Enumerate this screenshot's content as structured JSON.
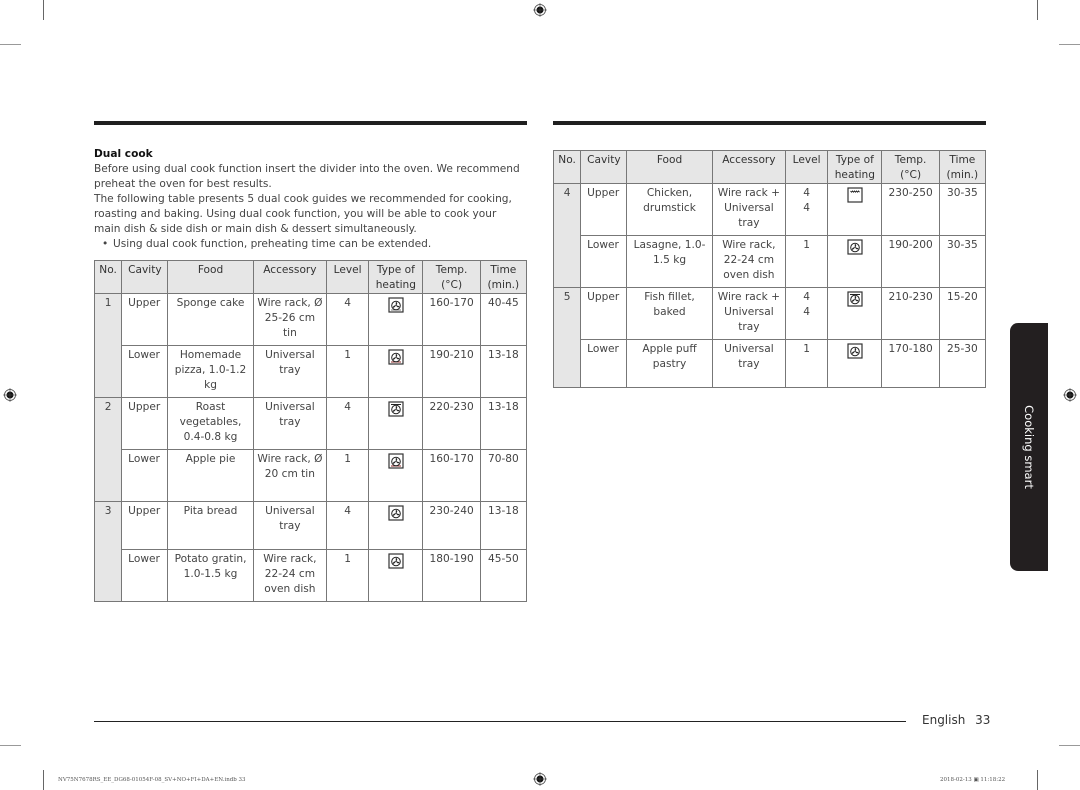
{
  "document": {
    "section_heading": "Dual cook",
    "paragraphs": [
      "Before using dual cook function insert the divider into the oven. We recommend preheat the oven for best results.",
      "The following table presents 5 dual cook guides we recommended for cooking, roasting and baking. Using dual cook function, you will be able to cook your main dish & side dish or main dish & dessert simultaneously."
    ],
    "bullet": "Using dual cook function, preheating time can be extended.",
    "bullet_symbol": "•"
  },
  "table": {
    "headers": {
      "no": "No.",
      "cavity": "Cavity",
      "food": "Food",
      "accessory": "Accessory",
      "level": "Level",
      "heating": "Type of heating",
      "temp": "Temp. (°C)",
      "time": "Time (min.)"
    },
    "groups": [
      {
        "no": "1",
        "rows": [
          {
            "cavity": "Upper",
            "food": "Sponge cake",
            "accessory": "Wire rack, Ø 25-26 cm tin",
            "level": "4",
            "heating_icon": "fan-heating-top-bottom-icon",
            "temp": "160-170",
            "time": "40-45"
          },
          {
            "cavity": "Lower",
            "food": "Homemade pizza, 1.0-1.2 kg",
            "accessory": "Universal tray",
            "level": "1",
            "heating_icon": "fan-heating-bottom-icon",
            "temp": "190-210",
            "time": "13-18"
          }
        ]
      },
      {
        "no": "2",
        "rows": [
          {
            "cavity": "Upper",
            "food": "Roast vegetables, 0.4-0.8 kg",
            "accessory": "Universal tray",
            "level": "4",
            "heating_icon": "fan-heating-top-icon",
            "temp": "220-230",
            "time": "13-18"
          },
          {
            "cavity": "Lower",
            "food": "Apple pie",
            "accessory": "Wire rack, Ø 20 cm tin",
            "level": "1",
            "heating_icon": "fan-heating-bottom-icon",
            "temp": "160-170",
            "time": "70-80"
          }
        ]
      },
      {
        "no": "3",
        "rows": [
          {
            "cavity": "Upper",
            "food": "Pita bread",
            "accessory": "Universal tray",
            "level": "4",
            "heating_icon": "fan-heating-icon",
            "temp": "230-240",
            "time": "13-18"
          },
          {
            "cavity": "Lower",
            "food": "Potato gratin, 1.0-1.5 kg",
            "accessory": "Wire rack, 22-24 cm oven dish",
            "level": "1",
            "heating_icon": "fan-heating-icon",
            "temp": "180-190",
            "time": "45-50"
          }
        ]
      },
      {
        "no": "4",
        "rows": [
          {
            "cavity": "Upper",
            "food": "Chicken, drumstick",
            "accessory": "Wire rack + Universal tray",
            "level": "4\n4",
            "heating_icon": "large-grill-icon",
            "temp": "230-250",
            "time": "30-35"
          },
          {
            "cavity": "Lower",
            "food": "Lasagne, 1.0-1.5 kg",
            "accessory": "Wire rack, 22-24 cm oven dish",
            "level": "1",
            "heating_icon": "fan-heating-icon",
            "temp": "190-200",
            "time": "30-35"
          }
        ]
      },
      {
        "no": "5",
        "rows": [
          {
            "cavity": "Upper",
            "food": "Fish fillet, baked",
            "accessory": "Wire rack + Universal tray",
            "level": "4\n4",
            "heating_icon": "fan-heating-top-icon",
            "temp": "210-230",
            "time": "15-20"
          },
          {
            "cavity": "Lower",
            "food": "Apple puff pastry",
            "accessory": "Universal tray",
            "level": "1",
            "heating_icon": "fan-heating-icon",
            "temp": "170-180",
            "time": "25-30"
          }
        ]
      }
    ]
  },
  "side_tab": {
    "label": "Cooking smart"
  },
  "footer": {
    "language": "English",
    "page_number": "33"
  },
  "print_info": {
    "file": "NV75N7678RS_EE_DG68-01054F-08_SV+NO+FI+DA+EN.indb   33",
    "timestamp": "2018-02-13   ▣ 11:18:22"
  }
}
